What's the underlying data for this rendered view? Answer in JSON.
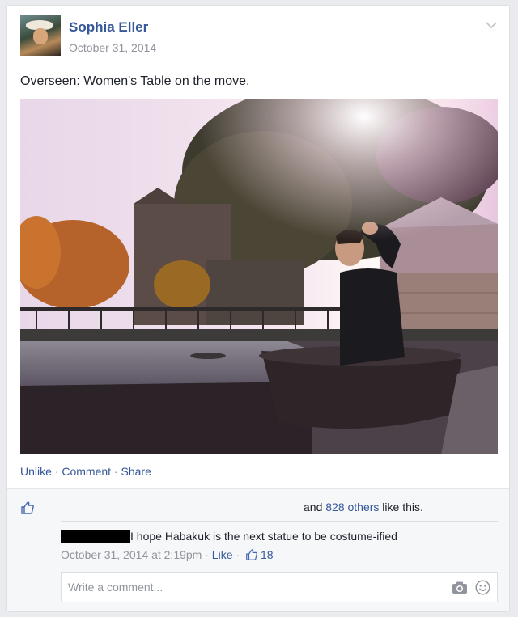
{
  "post": {
    "author": "Sophia Eller",
    "date": "October 31, 2014",
    "text": "Overseen: Women's Table on the move.",
    "options_icon": "chevron-down-icon"
  },
  "actions": {
    "unlike": "Unlike",
    "dot1": " · ",
    "comment": "Comment",
    "dot2": " · ",
    "share": "Share"
  },
  "likes": {
    "icon": "thumbs-up-icon",
    "prefix": "and ",
    "others": "828 others",
    "suffix": " like this."
  },
  "comment": {
    "text": "I hope Habakuk is the next statue to be costume-ified",
    "time": "October 31, 2014 at 2:19pm",
    "dot": " · ",
    "like": "Like",
    "dot2": " · ",
    "like_count": "18"
  },
  "composer": {
    "placeholder": "Write a comment...",
    "camera_icon": "camera-icon",
    "emoji_icon": "smiley-icon"
  },
  "colors": {
    "link": "#365899",
    "meta": "#90949c",
    "background": "#e9ebee"
  }
}
